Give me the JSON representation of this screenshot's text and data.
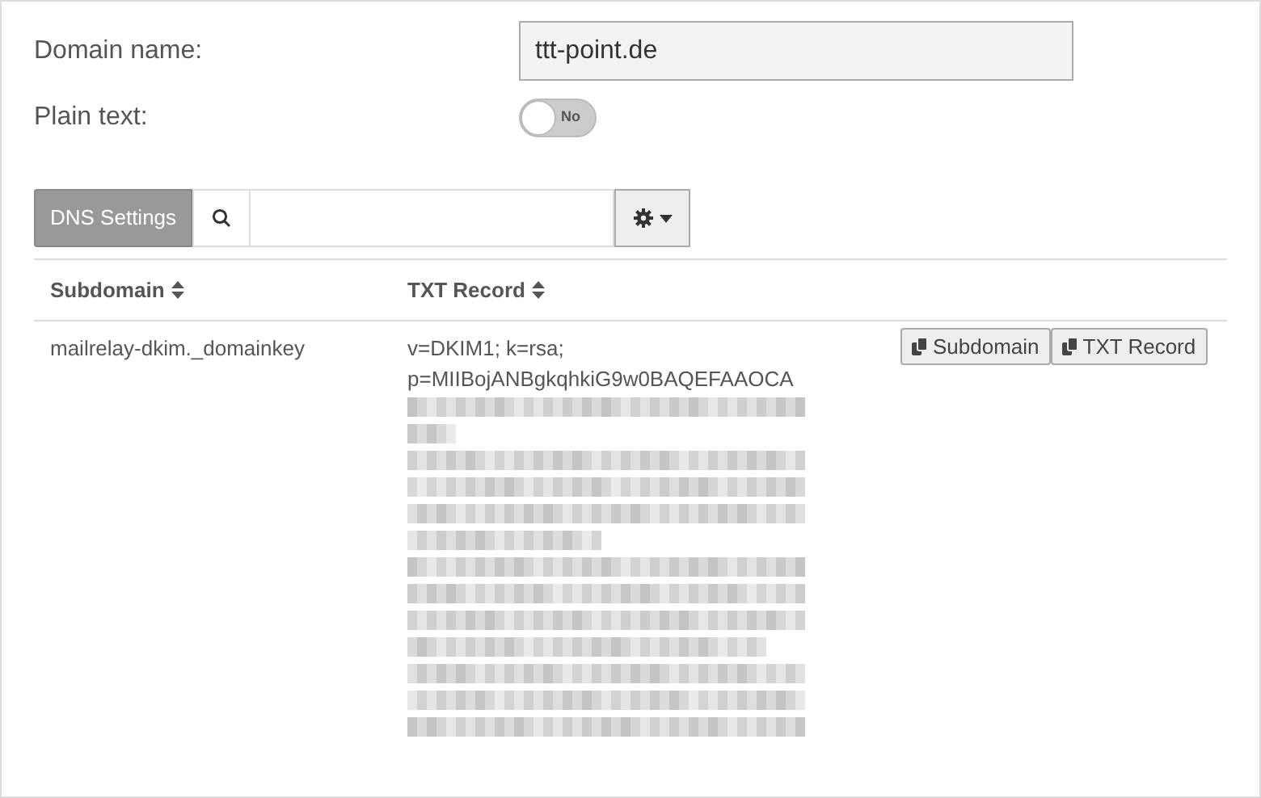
{
  "form": {
    "domain_label": "Domain name:",
    "domain_value": "ttt-point.de",
    "plain_text_label": "Plain text:",
    "plain_text_toggle": {
      "on": false,
      "label": "No"
    }
  },
  "toolbar": {
    "button": "DNS Settings"
  },
  "table": {
    "columns": [
      {
        "label": "Subdomain",
        "sortable": true
      },
      {
        "label": "TXT Record",
        "sortable": true
      }
    ],
    "rows": [
      {
        "subdomain": "mailrelay-dkim._domainkey",
        "txt_lines": [
          "v=DKIM1; k=rsa;",
          "p=MIIBojANBgkqhkiG9w0BAQEFAAOCA"
        ],
        "redacted": true,
        "actions": [
          "Subdomain",
          "TXT Record"
        ]
      }
    ]
  }
}
